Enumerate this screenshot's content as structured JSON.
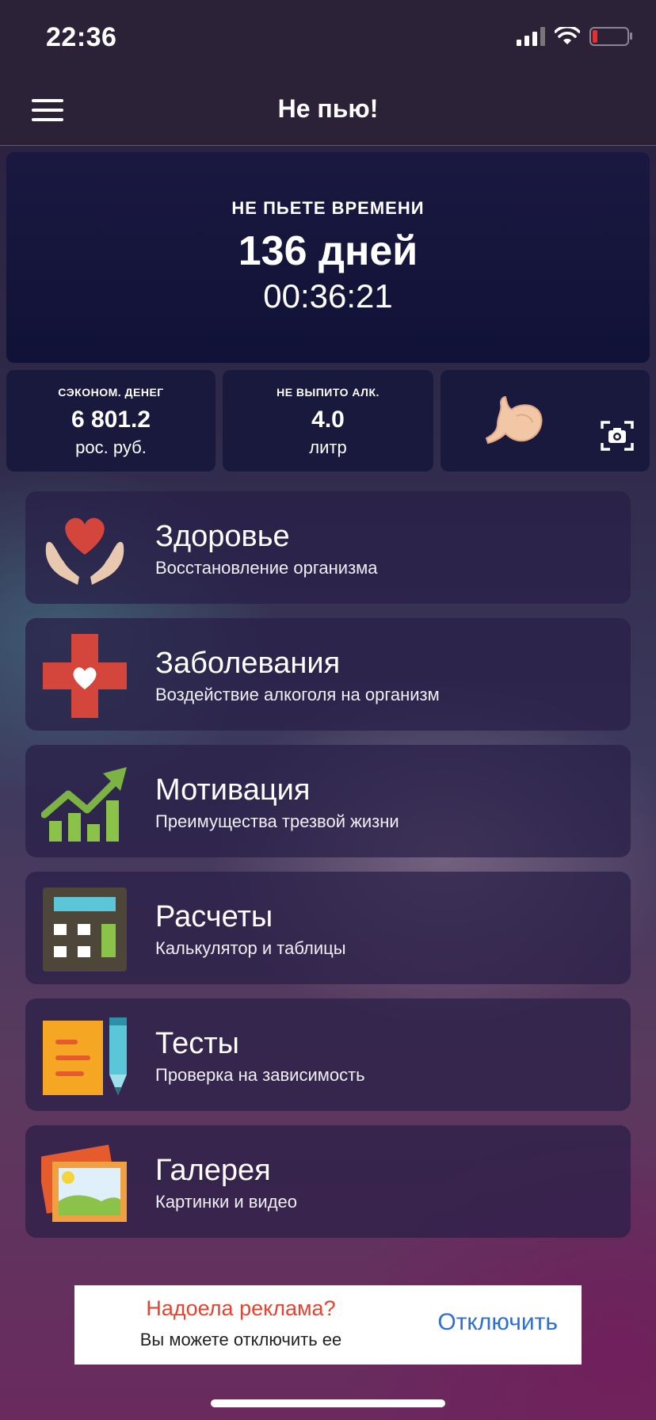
{
  "status_bar": {
    "time": "22:36"
  },
  "header": {
    "title": "Не пью!"
  },
  "hero": {
    "label": "НЕ ПЬЕТЕ ВРЕМЕНИ",
    "days": "136 дней",
    "time": "00:36:21"
  },
  "stats": [
    {
      "label": "СЭКОНОМ. ДЕНЕГ",
      "value": "6 801.2",
      "unit": "рос. руб."
    },
    {
      "label": "НЕ ВЫПИТО АЛК.",
      "value": "4.0",
      "unit": "литр"
    }
  ],
  "organ_tile": {
    "icon": "stomach-icon",
    "action_icon": "camera-icon"
  },
  "menu": [
    {
      "title": "Здоровье",
      "subtitle": "Восстановление организма",
      "icon": "heart-hands-icon"
    },
    {
      "title": "Заболевания",
      "subtitle": "Воздействие алкоголя на организм",
      "icon": "medical-cross-icon"
    },
    {
      "title": "Мотивация",
      "subtitle": "Преимущества трезвой жизни",
      "icon": "growth-chart-icon"
    },
    {
      "title": "Расчеты",
      "subtitle": "Калькулятор и таблицы",
      "icon": "calculator-icon"
    },
    {
      "title": "Тесты",
      "subtitle": "Проверка на зависимость",
      "icon": "test-pencil-icon"
    },
    {
      "title": "Галерея",
      "subtitle": "Картинки и видео",
      "icon": "gallery-icon"
    }
  ],
  "ad_banner": {
    "title": "Надоела реклама?",
    "subtitle": "Вы можете отключить ее",
    "button": "Отключить"
  },
  "colors": {
    "ad_title": "#e5432f",
    "ad_button": "#2d6fd8",
    "battery_low": "#e5302c"
  }
}
